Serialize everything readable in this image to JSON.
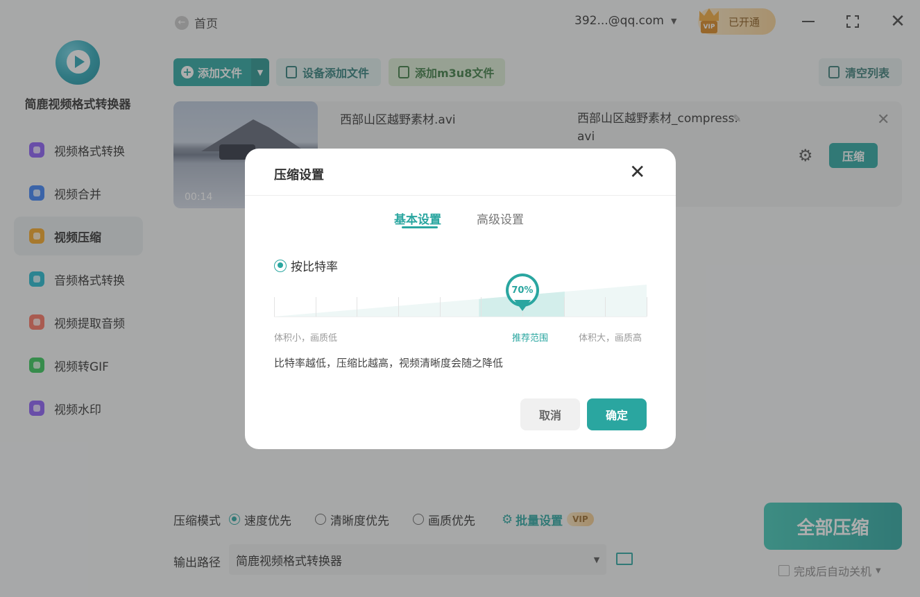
{
  "app": {
    "name": "简鹿视频格式转换器",
    "accent_color": "#2aa6a0"
  },
  "sidebar": {
    "items": [
      {
        "label": "视频格式转换",
        "icon": "video-convert-icon",
        "color": "#8b5cf6",
        "active": false
      },
      {
        "label": "视频合并",
        "icon": "video-merge-icon",
        "color": "#3b82f6",
        "active": false
      },
      {
        "label": "视频压缩",
        "icon": "video-compress-icon",
        "color": "#f5a623",
        "active": true
      },
      {
        "label": "音频格式转换",
        "icon": "audio-convert-icon",
        "color": "#22b8cf",
        "active": false
      },
      {
        "label": "视频提取音频",
        "icon": "extract-audio-icon",
        "color": "#f97360",
        "active": false
      },
      {
        "label": "视频转GIF",
        "icon": "gif-icon",
        "color": "#34c759",
        "active": false
      },
      {
        "label": "视频水印",
        "icon": "watermark-icon",
        "color": "#8b5cf6",
        "active": false
      }
    ]
  },
  "topbar": {
    "home_label": "首页",
    "account": "392...@qq.com",
    "vip_label": "已开通",
    "vip_badge": "VIP"
  },
  "toolbar": {
    "add_file": "添加文件",
    "device_add": "设备添加文件",
    "add_m3u8": "添加m3u8文件",
    "clear_list": "清空列表"
  },
  "files": [
    {
      "name": "西部山区越野素材.avi",
      "output_name": "西部山区越野素材_compress.avi",
      "duration": "00:14",
      "action_label": "压缩"
    }
  ],
  "bottom": {
    "mode_label": "压缩模式",
    "modes": [
      {
        "label": "速度优先",
        "selected": true
      },
      {
        "label": "清晰度优先",
        "selected": false
      },
      {
        "label": "画质优先",
        "selected": false
      }
    ],
    "batch_label": "批量设置",
    "vip_tag": "VIP",
    "output_label": "输出路径",
    "output_path": "简鹿视频格式转换器",
    "compress_all": "全部压缩",
    "auto_shutdown": "完成后自动关机"
  },
  "dialog": {
    "title": "压缩设置",
    "tabs": [
      {
        "label": "基本设置",
        "active": true
      },
      {
        "label": "高级设置",
        "active": false
      }
    ],
    "mode_option": "按比特率",
    "bitrate_percent": 70,
    "bitrate_label": "70%",
    "slider_low_label": "体积小，画质低",
    "slider_recommended_label": "推荐范围",
    "slider_high_label": "体积大，画质高",
    "recommended_range": [
      55,
      78
    ],
    "hint": "比特率越低，压缩比越高，视频清晰度会随之降低",
    "cancel_label": "取消",
    "confirm_label": "确定"
  }
}
